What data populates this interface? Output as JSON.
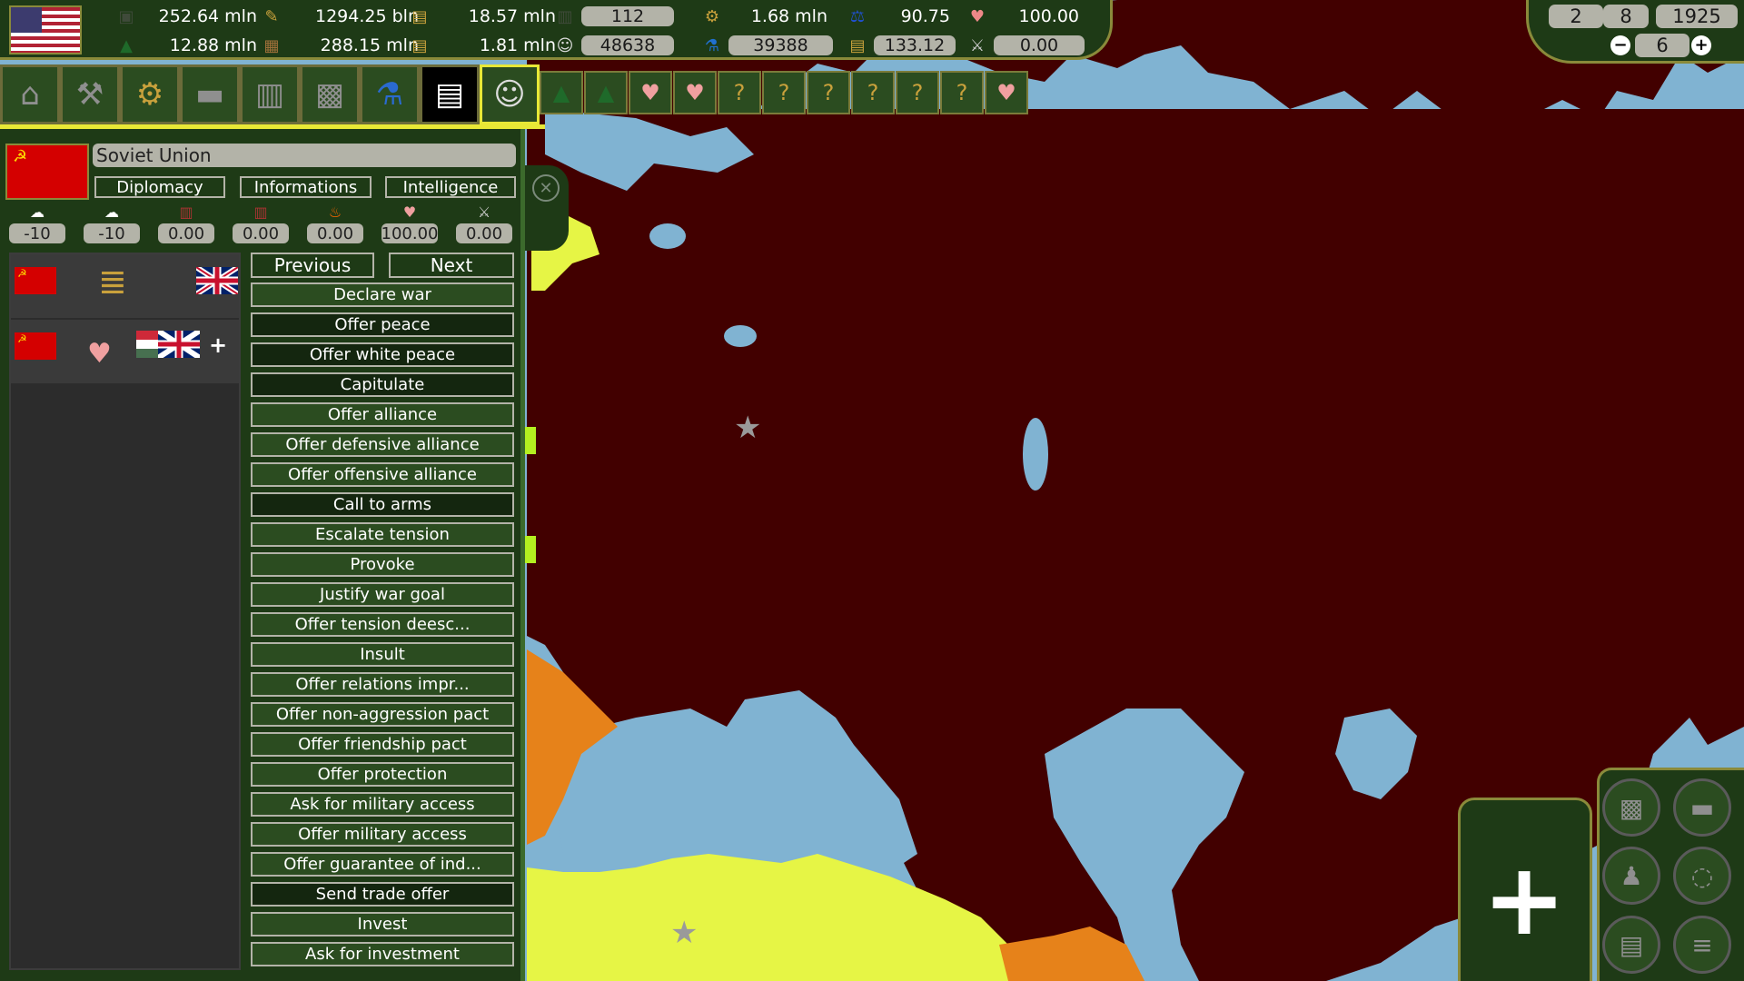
{
  "top_bar": {
    "player_flag": "usa-flag",
    "resources": [
      {
        "name": "population",
        "icon": "population-icon",
        "value": "252.64 mln"
      },
      {
        "name": "money",
        "icon": "money-icon",
        "value": "1294.25 bln"
      },
      {
        "name": "goods",
        "icon": "goods-icon",
        "value": "18.57 mln"
      },
      {
        "name": "buildings",
        "icon": "building-icon",
        "value": "112"
      },
      {
        "name": "industry",
        "icon": "gear-icon",
        "value": "1.68 mln"
      },
      {
        "name": "stability",
        "icon": "scales-icon",
        "value": "90.75"
      },
      {
        "name": "relations",
        "icon": "heart-icon",
        "value": "100.00"
      },
      {
        "name": "army",
        "icon": "soldier-icon",
        "value": "12.88 mln"
      },
      {
        "name": "resources",
        "icon": "resource-pile-icon",
        "value": "288.15 mln"
      },
      {
        "name": "goods_income",
        "icon": "goods-plus-icon",
        "value": "1.81 mln"
      },
      {
        "name": "ideology",
        "icon": "theater-icon",
        "value": "48638"
      },
      {
        "name": "research",
        "icon": "flask-icon",
        "value": "39388"
      },
      {
        "name": "goods_stock",
        "icon": "goods-stock-icon",
        "value": "133.12"
      },
      {
        "name": "war_exhaustion",
        "icon": "sword-icon",
        "value": "0.00"
      }
    ]
  },
  "date": {
    "day": "2",
    "month": "8",
    "year": "1925",
    "speed": "6",
    "minus_label": "−",
    "plus_label": "+"
  },
  "toolbar": {
    "main_buttons": [
      "government-icon",
      "hammer-icon",
      "gear-icon",
      "tank-icon",
      "factory-icon",
      "map-icon",
      "flask-icon",
      "chart-icon",
      "theater-masks-icon"
    ],
    "notifications": [
      "army-icon",
      "army-icon",
      "handshake-icon",
      "handshake-icon",
      "trade-offer-icon",
      "trade-offer-icon",
      "trade-offer-icon",
      "trade-offer-icon",
      "trade-offer-icon",
      "trade-offer-icon",
      "handshake-icon"
    ]
  },
  "country_panel": {
    "country_name": "Soviet Union",
    "tabs": {
      "diplomacy": "Diplomacy",
      "informations": "Informations",
      "intelligence": "Intelligence"
    },
    "relations": [
      {
        "icon": "opinion-icon",
        "value": "-10"
      },
      {
        "icon": "opinion-icon",
        "value": "-10"
      },
      {
        "icon": "factory-small-icon",
        "value": "0.00"
      },
      {
        "icon": "factory-small-icon",
        "value": "0.00"
      },
      {
        "icon": "fire-icon",
        "value": "0.00"
      },
      {
        "icon": "heart-icon",
        "value": "100.00"
      },
      {
        "icon": "sword-icon",
        "value": "0.00"
      }
    ],
    "previous_label": "Previous",
    "next_label": "Next",
    "actions": [
      {
        "label": "Declare war",
        "dark": false
      },
      {
        "label": "Offer peace",
        "dark": true
      },
      {
        "label": "Offer white peace",
        "dark": true
      },
      {
        "label": "Capitulate",
        "dark": true
      },
      {
        "label": "Offer alliance",
        "dark": false
      },
      {
        "label": "Offer defensive alliance",
        "dark": false
      },
      {
        "label": "Offer offensive alliance",
        "dark": false
      },
      {
        "label": "Call to arms",
        "dark": true
      },
      {
        "label": "Escalate tension",
        "dark": false
      },
      {
        "label": "Provoke",
        "dark": false
      },
      {
        "label": "Justify war goal",
        "dark": false
      },
      {
        "label": "Offer tension deesc...",
        "dark": false
      },
      {
        "label": "Insult",
        "dark": false
      },
      {
        "label": "Offer relations impr...",
        "dark": false
      },
      {
        "label": "Offer non-aggression pact",
        "dark": false
      },
      {
        "label": "Offer friendship pact",
        "dark": false
      },
      {
        "label": "Offer protection",
        "dark": false
      },
      {
        "label": "Ask for military access",
        "dark": false
      },
      {
        "label": "Offer military access",
        "dark": false
      },
      {
        "label": "Offer guarantee of ind...",
        "dark": false
      },
      {
        "label": "Send trade offer",
        "dark": true
      },
      {
        "label": "Invest",
        "dark": false
      },
      {
        "label": "Ask for investment",
        "dark": false
      }
    ]
  },
  "map": {
    "colors": {
      "ocean": "#80b3d2",
      "ussr": "#420000",
      "turkey": "#e6f545",
      "orange": "#e6821a",
      "lime": "#b4f020"
    }
  },
  "map_controls": {
    "zoom_label": "+",
    "modes": [
      "map-icon",
      "tank-icon",
      "person-icon",
      "region-icon",
      "document-icon",
      "list-icon"
    ]
  }
}
